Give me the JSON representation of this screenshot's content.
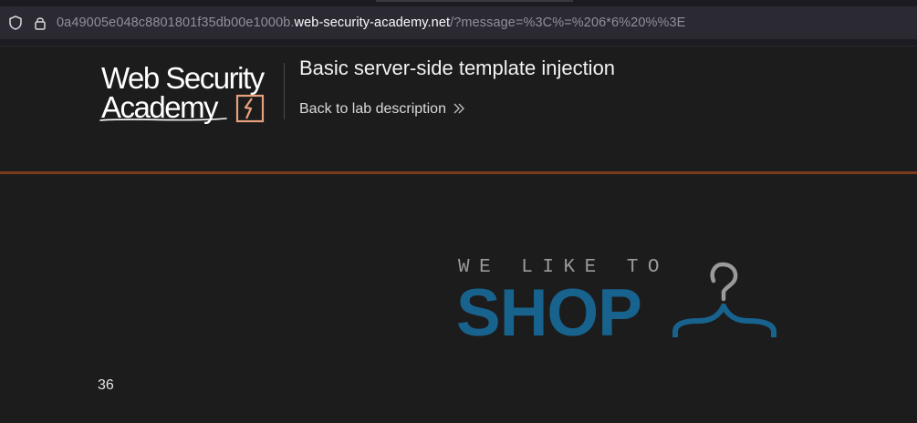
{
  "browser": {
    "url_prefix": "0a49005e048c8801801f35db00e1000b.",
    "url_host": "web-security-academy.net",
    "url_path": "/?message=%3C%=%206*6%20%%3E",
    "icons": [
      "shield-icon",
      "lock-icon"
    ]
  },
  "header": {
    "logo_line1": "Web Security",
    "logo_line2": "Academy",
    "lab_title": "Basic server-side template injection",
    "back_link": "Back to lab description"
  },
  "banner": {
    "tagline": "WE LIKE TO",
    "word": "SHOP",
    "icon": "hanger-icon",
    "colors": {
      "word": "#17638e",
      "tagline": "#9a9a9a"
    }
  },
  "content": {
    "message": "36"
  },
  "colors": {
    "background": "#1c1c1c",
    "accent_line": "#7a3a1c",
    "logo_mark": "#e8a07c"
  }
}
